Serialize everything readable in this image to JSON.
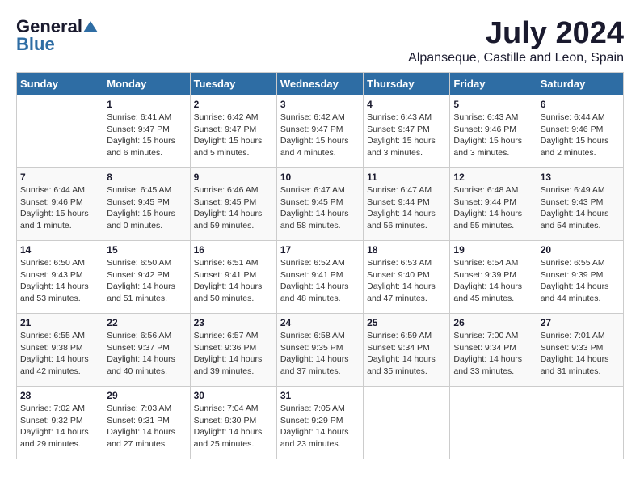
{
  "header": {
    "logo_general": "General",
    "logo_blue": "Blue",
    "month_title": "July 2024",
    "location": "Alpanseque, Castille and Leon, Spain"
  },
  "days_of_week": [
    "Sunday",
    "Monday",
    "Tuesday",
    "Wednesday",
    "Thursday",
    "Friday",
    "Saturday"
  ],
  "weeks": [
    [
      {
        "day": "",
        "sunrise": "",
        "sunset": "",
        "daylight": ""
      },
      {
        "day": "1",
        "sunrise": "Sunrise: 6:41 AM",
        "sunset": "Sunset: 9:47 PM",
        "daylight": "Daylight: 15 hours and 6 minutes."
      },
      {
        "day": "2",
        "sunrise": "Sunrise: 6:42 AM",
        "sunset": "Sunset: 9:47 PM",
        "daylight": "Daylight: 15 hours and 5 minutes."
      },
      {
        "day": "3",
        "sunrise": "Sunrise: 6:42 AM",
        "sunset": "Sunset: 9:47 PM",
        "daylight": "Daylight: 15 hours and 4 minutes."
      },
      {
        "day": "4",
        "sunrise": "Sunrise: 6:43 AM",
        "sunset": "Sunset: 9:47 PM",
        "daylight": "Daylight: 15 hours and 3 minutes."
      },
      {
        "day": "5",
        "sunrise": "Sunrise: 6:43 AM",
        "sunset": "Sunset: 9:46 PM",
        "daylight": "Daylight: 15 hours and 3 minutes."
      },
      {
        "day": "6",
        "sunrise": "Sunrise: 6:44 AM",
        "sunset": "Sunset: 9:46 PM",
        "daylight": "Daylight: 15 hours and 2 minutes."
      }
    ],
    [
      {
        "day": "7",
        "sunrise": "Sunrise: 6:44 AM",
        "sunset": "Sunset: 9:46 PM",
        "daylight": "Daylight: 15 hours and 1 minute."
      },
      {
        "day": "8",
        "sunrise": "Sunrise: 6:45 AM",
        "sunset": "Sunset: 9:45 PM",
        "daylight": "Daylight: 15 hours and 0 minutes."
      },
      {
        "day": "9",
        "sunrise": "Sunrise: 6:46 AM",
        "sunset": "Sunset: 9:45 PM",
        "daylight": "Daylight: 14 hours and 59 minutes."
      },
      {
        "day": "10",
        "sunrise": "Sunrise: 6:47 AM",
        "sunset": "Sunset: 9:45 PM",
        "daylight": "Daylight: 14 hours and 58 minutes."
      },
      {
        "day": "11",
        "sunrise": "Sunrise: 6:47 AM",
        "sunset": "Sunset: 9:44 PM",
        "daylight": "Daylight: 14 hours and 56 minutes."
      },
      {
        "day": "12",
        "sunrise": "Sunrise: 6:48 AM",
        "sunset": "Sunset: 9:44 PM",
        "daylight": "Daylight: 14 hours and 55 minutes."
      },
      {
        "day": "13",
        "sunrise": "Sunrise: 6:49 AM",
        "sunset": "Sunset: 9:43 PM",
        "daylight": "Daylight: 14 hours and 54 minutes."
      }
    ],
    [
      {
        "day": "14",
        "sunrise": "Sunrise: 6:50 AM",
        "sunset": "Sunset: 9:43 PM",
        "daylight": "Daylight: 14 hours and 53 minutes."
      },
      {
        "day": "15",
        "sunrise": "Sunrise: 6:50 AM",
        "sunset": "Sunset: 9:42 PM",
        "daylight": "Daylight: 14 hours and 51 minutes."
      },
      {
        "day": "16",
        "sunrise": "Sunrise: 6:51 AM",
        "sunset": "Sunset: 9:41 PM",
        "daylight": "Daylight: 14 hours and 50 minutes."
      },
      {
        "day": "17",
        "sunrise": "Sunrise: 6:52 AM",
        "sunset": "Sunset: 9:41 PM",
        "daylight": "Daylight: 14 hours and 48 minutes."
      },
      {
        "day": "18",
        "sunrise": "Sunrise: 6:53 AM",
        "sunset": "Sunset: 9:40 PM",
        "daylight": "Daylight: 14 hours and 47 minutes."
      },
      {
        "day": "19",
        "sunrise": "Sunrise: 6:54 AM",
        "sunset": "Sunset: 9:39 PM",
        "daylight": "Daylight: 14 hours and 45 minutes."
      },
      {
        "day": "20",
        "sunrise": "Sunrise: 6:55 AM",
        "sunset": "Sunset: 9:39 PM",
        "daylight": "Daylight: 14 hours and 44 minutes."
      }
    ],
    [
      {
        "day": "21",
        "sunrise": "Sunrise: 6:55 AM",
        "sunset": "Sunset: 9:38 PM",
        "daylight": "Daylight: 14 hours and 42 minutes."
      },
      {
        "day": "22",
        "sunrise": "Sunrise: 6:56 AM",
        "sunset": "Sunset: 9:37 PM",
        "daylight": "Daylight: 14 hours and 40 minutes."
      },
      {
        "day": "23",
        "sunrise": "Sunrise: 6:57 AM",
        "sunset": "Sunset: 9:36 PM",
        "daylight": "Daylight: 14 hours and 39 minutes."
      },
      {
        "day": "24",
        "sunrise": "Sunrise: 6:58 AM",
        "sunset": "Sunset: 9:35 PM",
        "daylight": "Daylight: 14 hours and 37 minutes."
      },
      {
        "day": "25",
        "sunrise": "Sunrise: 6:59 AM",
        "sunset": "Sunset: 9:34 PM",
        "daylight": "Daylight: 14 hours and 35 minutes."
      },
      {
        "day": "26",
        "sunrise": "Sunrise: 7:00 AM",
        "sunset": "Sunset: 9:34 PM",
        "daylight": "Daylight: 14 hours and 33 minutes."
      },
      {
        "day": "27",
        "sunrise": "Sunrise: 7:01 AM",
        "sunset": "Sunset: 9:33 PM",
        "daylight": "Daylight: 14 hours and 31 minutes."
      }
    ],
    [
      {
        "day": "28",
        "sunrise": "Sunrise: 7:02 AM",
        "sunset": "Sunset: 9:32 PM",
        "daylight": "Daylight: 14 hours and 29 minutes."
      },
      {
        "day": "29",
        "sunrise": "Sunrise: 7:03 AM",
        "sunset": "Sunset: 9:31 PM",
        "daylight": "Daylight: 14 hours and 27 minutes."
      },
      {
        "day": "30",
        "sunrise": "Sunrise: 7:04 AM",
        "sunset": "Sunset: 9:30 PM",
        "daylight": "Daylight: 14 hours and 25 minutes."
      },
      {
        "day": "31",
        "sunrise": "Sunrise: 7:05 AM",
        "sunset": "Sunset: 9:29 PM",
        "daylight": "Daylight: 14 hours and 23 minutes."
      },
      {
        "day": "",
        "sunrise": "",
        "sunset": "",
        "daylight": ""
      },
      {
        "day": "",
        "sunrise": "",
        "sunset": "",
        "daylight": ""
      },
      {
        "day": "",
        "sunrise": "",
        "sunset": "",
        "daylight": ""
      }
    ]
  ]
}
